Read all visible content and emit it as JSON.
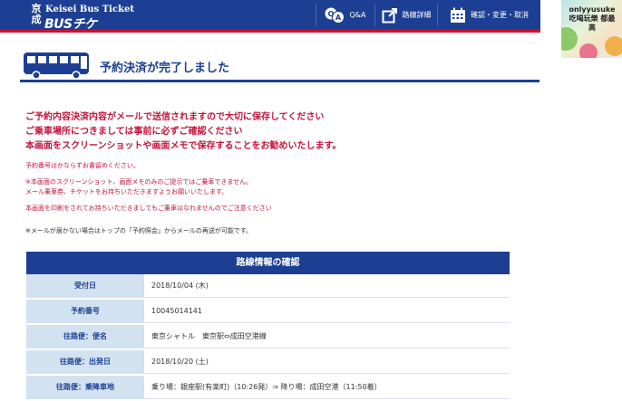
{
  "header": {
    "logo_kanji": "京成",
    "logo_en": "Keisei Bus Ticket",
    "logo_bus": "BUSチケ",
    "nav": [
      {
        "label": "Q&A",
        "icon": "qa-icon"
      },
      {
        "label": "路線詳細",
        "icon": "external-link-icon"
      },
      {
        "label": "確認・変更・取消",
        "icon": "calendar-icon"
      }
    ]
  },
  "ad": {
    "text": "onlyyusuke 吃喝玩樂 都最高"
  },
  "page": {
    "title": "予約決済が完了しました"
  },
  "messages": {
    "line1": "ご予約内容決済内容がメールで送信されますので大切に保存してください",
    "line2": "ご乗車場所につきましては事前に必ずご確認ください",
    "line3": "本画面をスクリーンショットや画面メモで保存することをお勧めいたします。",
    "note1": "予約番号はかならずお書留めください。",
    "note2a": "※本画面のスクリーンショット、画面メモのみのご提示ではご乗車できません。",
    "note2b": "メール乗車券、チケットをお持ちいただきますようお願いいたします。",
    "note3": "本画面を印刷をされてお持ちいただきましてもご乗車はなれませんのでご注意ください",
    "gray": "※メールが届かない場合はトップの「予約照会」からメールの再送が可能です。"
  },
  "table": {
    "heading": "路線情報の確認",
    "rows": [
      {
        "label": "受付日",
        "value": "2018/10/04 (木)"
      },
      {
        "label": "予約番号",
        "value": "10045014141"
      },
      {
        "label": "往路便：便名",
        "value": "東京シャトル　東京駅⇔成田空港線"
      },
      {
        "label": "往路便：出発日",
        "value": "2018/10/20 (土)"
      },
      {
        "label": "往路便：乗降車地",
        "value": "乗り場：銀座駅(有楽町)（10:26発）⇒ 降り場：成田空港（11:50着）"
      }
    ]
  }
}
